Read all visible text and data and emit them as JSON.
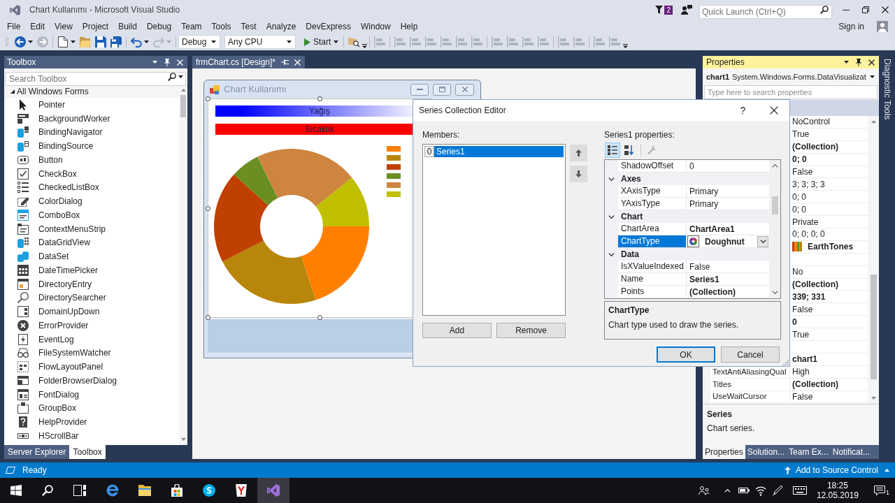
{
  "window": {
    "title": "Chart Kullanımı - Microsoft Visual Studio",
    "notifications": "2",
    "quick_launch": {
      "placeholder": "Quick Launch (Ctrl+Q)"
    }
  },
  "menu": {
    "items": [
      "File",
      "Edit",
      "View",
      "Project",
      "Build",
      "Debug",
      "Team",
      "Tools",
      "Test",
      "Analyze",
      "DevExpress",
      "Window",
      "Help"
    ],
    "sign_in": "Sign in"
  },
  "toolbar": {
    "items": [
      {
        "kind": "back",
        "disabled": false
      },
      {
        "kind": "forward",
        "disabled": true
      },
      {
        "kind": "separator"
      },
      {
        "kind": "new",
        "disabled": false
      },
      {
        "kind": "open",
        "disabled": false
      },
      {
        "kind": "save",
        "disabled": false
      },
      {
        "kind": "save_all",
        "disabled": false
      },
      {
        "kind": "separator"
      },
      {
        "kind": "undo",
        "disabled": false
      },
      {
        "kind": "redo",
        "disabled": true
      },
      {
        "kind": "separator"
      },
      {
        "kind": "select",
        "value": "Debug"
      },
      {
        "kind": "select",
        "value": "Any CPU"
      },
      {
        "kind": "start",
        "label": "Start"
      },
      {
        "kind": "separator"
      },
      {
        "kind": "find",
        "disabled": false
      },
      {
        "kind": "overflow"
      },
      {
        "kind": "separator"
      },
      {
        "kind": "layout",
        "disabled": true
      },
      {
        "kind": "separator"
      },
      {
        "kind": "layout",
        "disabled": true
      },
      {
        "kind": "layout",
        "disabled": true
      },
      {
        "kind": "layout",
        "disabled": true
      },
      {
        "kind": "layout",
        "disabled": true
      },
      {
        "kind": "layout",
        "disabled": true
      },
      {
        "kind": "layout",
        "disabled": true
      },
      {
        "kind": "separator"
      },
      {
        "kind": "layout",
        "disabled": true
      },
      {
        "kind": "layout",
        "disabled": true
      },
      {
        "kind": "layout",
        "disabled": true
      },
      {
        "kind": "layout",
        "disabled": true
      },
      {
        "kind": "separator"
      },
      {
        "kind": "layout",
        "disabled": true
      },
      {
        "kind": "layout",
        "disabled": true
      },
      {
        "kind": "separator"
      },
      {
        "kind": "layout",
        "disabled": true
      },
      {
        "kind": "layout",
        "disabled": true
      },
      {
        "kind": "overflow"
      }
    ]
  },
  "toolbox": {
    "title": "Toolbox",
    "search": {
      "placeholder": "Search Toolbox"
    },
    "groups": [
      {
        "label": "All Windows Forms",
        "expanded": true,
        "children": [
          {
            "label": "Pointer",
            "selected": false
          },
          {
            "label": "BackgroundWorker",
            "selected": false
          },
          {
            "label": "BindingNavigator",
            "selected": false
          },
          {
            "label": "BindingSource",
            "selected": false
          },
          {
            "label": "Button",
            "selected": false
          },
          {
            "label": "CheckBox",
            "selected": false
          },
          {
            "label": "CheckedListBox",
            "selected": false
          },
          {
            "label": "ColorDialog",
            "selected": false
          },
          {
            "label": "ComboBox",
            "selected": false
          },
          {
            "label": "ContextMenuStrip",
            "selected": false
          },
          {
            "label": "DataGridView",
            "selected": false
          },
          {
            "label": "DataSet",
            "selected": false
          },
          {
            "label": "DateTimePicker",
            "selected": false
          },
          {
            "label": "DirectoryEntry",
            "selected": false
          },
          {
            "label": "DirectorySearcher",
            "selected": false
          },
          {
            "label": "DomainUpDown",
            "selected": false
          },
          {
            "label": "ErrorProvider",
            "selected": false
          },
          {
            "label": "EventLog",
            "selected": false
          },
          {
            "label": "FileSystemWatcher",
            "selected": false
          },
          {
            "label": "FlowLayoutPanel",
            "selected": false
          },
          {
            "label": "FolderBrowserDialog",
            "selected": false
          },
          {
            "label": "FontDialog",
            "selected": false
          },
          {
            "label": "GroupBox",
            "selected": false
          },
          {
            "label": "HelpProvider",
            "selected": false
          },
          {
            "label": "HScrollBar",
            "selected": false
          }
        ]
      }
    ],
    "tabs": [
      {
        "label": "Server Explorer",
        "selected": false
      },
      {
        "label": "Toolbox",
        "selected": true
      }
    ]
  },
  "document_tabs": [
    {
      "label": "frmChart.cs [Design]*",
      "selected": true
    }
  ],
  "designer": {
    "form": {
      "title": "Chart Kullanımı",
      "chart": {
        "selected": true,
        "titles": [
          {
            "text": "Yağış",
            "kind": "gradient",
            "color": "#0000ff"
          },
          {
            "text": "Sıcaklık",
            "kind": "solid",
            "color": "#ff0000"
          }
        ],
        "legend": [
          {
            "color": "#ff8000"
          },
          {
            "color": "#b8860b"
          },
          {
            "color": "#c04000"
          },
          {
            "color": "#6b8e23"
          },
          {
            "color": "#cd853f"
          },
          {
            "color": "#c0c000"
          }
        ]
      }
    }
  },
  "dialog": {
    "title": "Series Collection Editor",
    "help": "?",
    "members": {
      "label": "Members:",
      "items": [
        {
          "index": "0",
          "name": "Series1",
          "selected": true
        }
      ]
    },
    "member_buttons": [
      "Add",
      "Remove"
    ],
    "properties": {
      "label": "Series1 properties:",
      "view_modes": [
        {
          "kind": "categorized",
          "selected": true
        },
        {
          "kind": "alphabetical",
          "selected": false
        }
      ],
      "property_pages": {
        "disabled": true
      },
      "rows": [
        {
          "kind": "property",
          "name": "ShadowOffset",
          "value": "0",
          "bold": false,
          "selected": false
        },
        {
          "kind": "category",
          "label": "Axes",
          "expanded": true
        },
        {
          "kind": "property",
          "name": "XAxisType",
          "value": "Primary",
          "bold": false,
          "selected": false
        },
        {
          "kind": "property",
          "name": "YAxisType",
          "value": "Primary",
          "bold": false,
          "selected": false
        },
        {
          "kind": "category",
          "label": "Chart",
          "expanded": true
        },
        {
          "kind": "property",
          "name": "ChartArea",
          "value": "ChartArea1",
          "bold": true,
          "selected": false
        },
        {
          "kind": "dropdown",
          "name": "ChartType",
          "value": "Doughnut",
          "bold": true,
          "selected": true
        },
        {
          "kind": "category",
          "label": "Data",
          "expanded": true
        },
        {
          "kind": "property",
          "name": "IsXValueIndexed",
          "value": "False",
          "bold": false,
          "selected": false
        },
        {
          "kind": "property",
          "name": "Name",
          "value": "Series1",
          "bold": true,
          "selected": false
        },
        {
          "kind": "property",
          "name": "Points",
          "value": "(Collection)",
          "bold": true,
          "selected": false
        }
      ],
      "description": {
        "title": "ChartType",
        "text": "Chart type used to draw the series."
      }
    },
    "buttons": [
      {
        "label": "OK",
        "default": true
      },
      {
        "label": "Cancel",
        "default": false
      }
    ]
  },
  "properties_window": {
    "title": "Properties",
    "object": {
      "name": "chart1",
      "type": "System.Windows.Forms.DataVisualizat"
    },
    "search": {
      "placeholder": "Type here to search properties"
    },
    "rows": [
      {
        "kind": "text",
        "value": "NoControl",
        "bold": false
      },
      {
        "kind": "text",
        "value": "True",
        "bold": false
      },
      {
        "kind": "text",
        "value": "(Collection)",
        "bold": true
      },
      {
        "kind": "text",
        "value": "0; 0",
        "bold": true
      },
      {
        "kind": "text",
        "value": "False",
        "bold": false
      },
      {
        "kind": "text",
        "value": "3; 3; 3; 3",
        "bold": false
      },
      {
        "kind": "text",
        "value": "0; 0",
        "bold": false
      },
      {
        "kind": "text",
        "value": "0; 0",
        "bold": false
      },
      {
        "kind": "text",
        "value": "Private",
        "bold": false
      },
      {
        "kind": "text",
        "value": "0; 0; 0; 0",
        "bold": false
      },
      {
        "kind": "palette",
        "value": "EarthTones",
        "bold": true
      },
      {
        "kind": "blank"
      },
      {
        "kind": "text",
        "value": "No",
        "bold": false
      },
      {
        "kind": "text",
        "value": "(Collection)",
        "bold": true
      },
      {
        "kind": "text",
        "value": "339; 331",
        "bold": true
      },
      {
        "kind": "text",
        "value": "False",
        "bold": false
      },
      {
        "kind": "text",
        "value": "0",
        "bold": true
      },
      {
        "kind": "text",
        "value": "True",
        "bold": false
      },
      {
        "kind": "blank"
      },
      {
        "kind": "text",
        "value": "chart1",
        "bold": true
      },
      {
        "kind": "text",
        "name": "TextAntiAliasingQual",
        "value": "High",
        "bold": false
      },
      {
        "kind": "text",
        "name": "Titles",
        "value": "(Collection)",
        "bold": true
      },
      {
        "kind": "text",
        "name": "UseWaitCursor",
        "value": "False",
        "bold": false
      }
    ],
    "description": {
      "title": "Series",
      "text": "Chart series."
    },
    "tabs": [
      {
        "label": "Properties",
        "selected": true
      },
      {
        "label": "Solution...",
        "selected": false
      },
      {
        "label": "Team Ex...",
        "selected": false
      },
      {
        "label": "Notificat...",
        "selected": false
      }
    ]
  },
  "side_tabs": [
    {
      "label": "Diagnostic Tools"
    }
  ],
  "status_bar": {
    "text": "Ready",
    "source_control": "Add to Source Control"
  },
  "taskbar": {
    "apps": [
      {
        "kind": "browser",
        "active": false
      },
      {
        "kind": "folders",
        "active": false
      },
      {
        "kind": "store",
        "active": false
      },
      {
        "kind": "messenger",
        "active": false
      },
      {
        "kind": "webapp",
        "active": false
      },
      {
        "kind": "ide",
        "active": true
      }
    ],
    "time": "18:25",
    "date": "12.05.2019",
    "notifications": "1"
  }
}
